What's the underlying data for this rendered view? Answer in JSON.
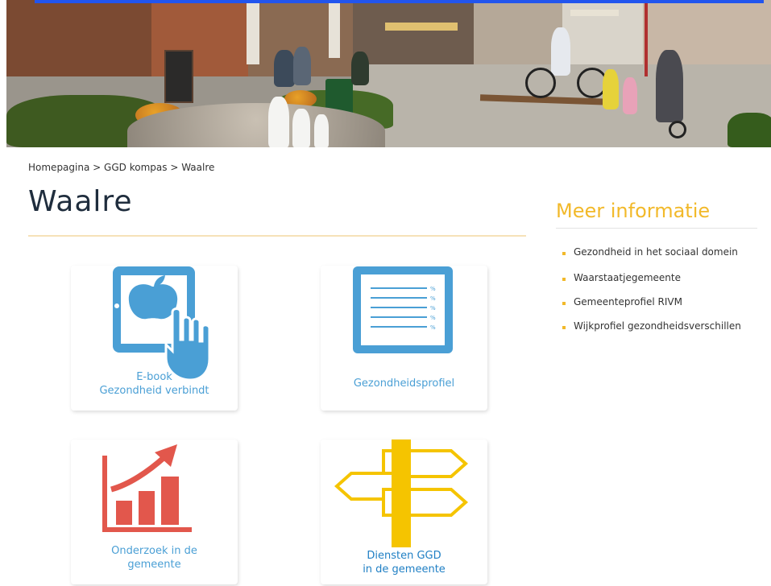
{
  "breadcrumb": {
    "items": [
      "Homepagina",
      "GGD kompas",
      "Waalre"
    ],
    "separator": ">"
  },
  "page": {
    "title": "Waalre"
  },
  "tiles": [
    {
      "label": "E-book\nGezondheid verbindt",
      "icon": "tablet-touch-apple-icon",
      "color": "#4a9fd5"
    },
    {
      "label": "Gezondheidsprofiel",
      "icon": "document-list-icon",
      "color": "#4a9fd5"
    },
    {
      "label": "Onderzoek in de\ngemeente",
      "icon": "bar-chart-growth-icon",
      "color": "#e2574c"
    },
    {
      "label": "Diensten GGD\nin de gemeente",
      "icon": "signpost-icon",
      "color": "#1f7fc4"
    }
  ],
  "sidebar": {
    "title": "Meer informatie",
    "links": [
      "Gezondheid in het sociaal domein",
      "Waarstaatjegemeente",
      "Gemeenteprofiel RIVM",
      "Wijkprofiel gezondheidsverschillen"
    ]
  },
  "colors": {
    "accent_yellow": "#f2b92a",
    "icon_blue": "#4a9fd5",
    "icon_red": "#e2574c",
    "signpost_yellow": "#f5c400",
    "title_dark": "#1f2d3d"
  }
}
